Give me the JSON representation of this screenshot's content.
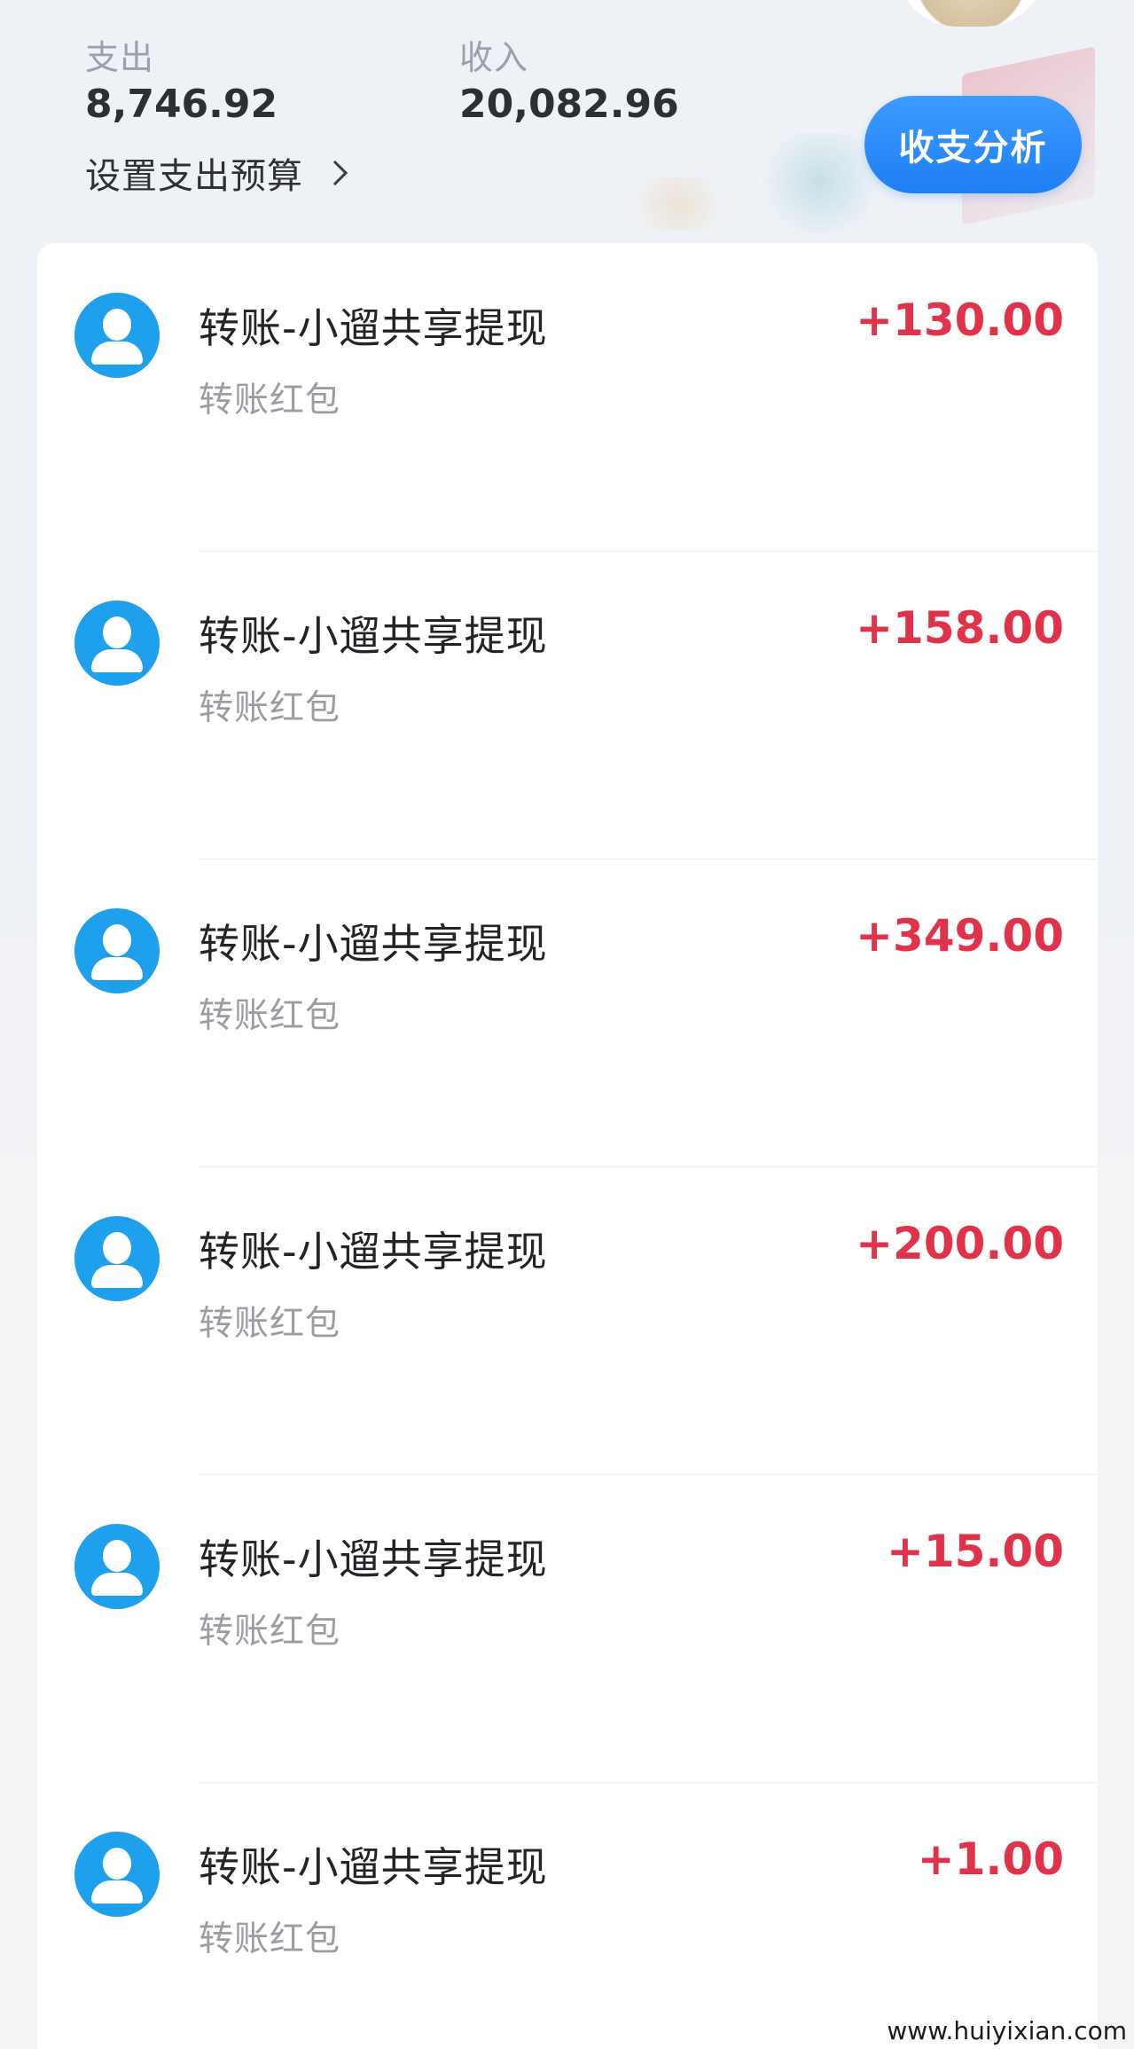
{
  "summary": {
    "expense_label": "支出",
    "expense_value": "8,746.92",
    "income_label": "收入",
    "income_value": "20,082.96",
    "budget_link": "设置支出预算",
    "analysis_button": "收支分析"
  },
  "transactions": [
    {
      "title": "转账-小遛共享提现",
      "subtitle": "转账红包",
      "amount": "+130.00"
    },
    {
      "title": "转账-小遛共享提现",
      "subtitle": "转账红包",
      "amount": "+158.00"
    },
    {
      "title": "转账-小遛共享提现",
      "subtitle": "转账红包",
      "amount": "+349.00"
    },
    {
      "title": "转账-小遛共享提现",
      "subtitle": "转账红包",
      "amount": "+200.00"
    },
    {
      "title": "转账-小遛共享提现",
      "subtitle": "转账红包",
      "amount": "+15.00"
    },
    {
      "title": "转账-小遛共享提现",
      "subtitle": "转账红包",
      "amount": "+1.00"
    }
  ],
  "watermark": "www.huiyixian.com",
  "colors": {
    "accent_blue": "#1e7ef5",
    "income_red": "#e0334a",
    "avatar_blue": "#1fa0ec"
  },
  "icons": {
    "avatar": "user-avatar-icon",
    "chevron": "chevron-right-icon"
  }
}
